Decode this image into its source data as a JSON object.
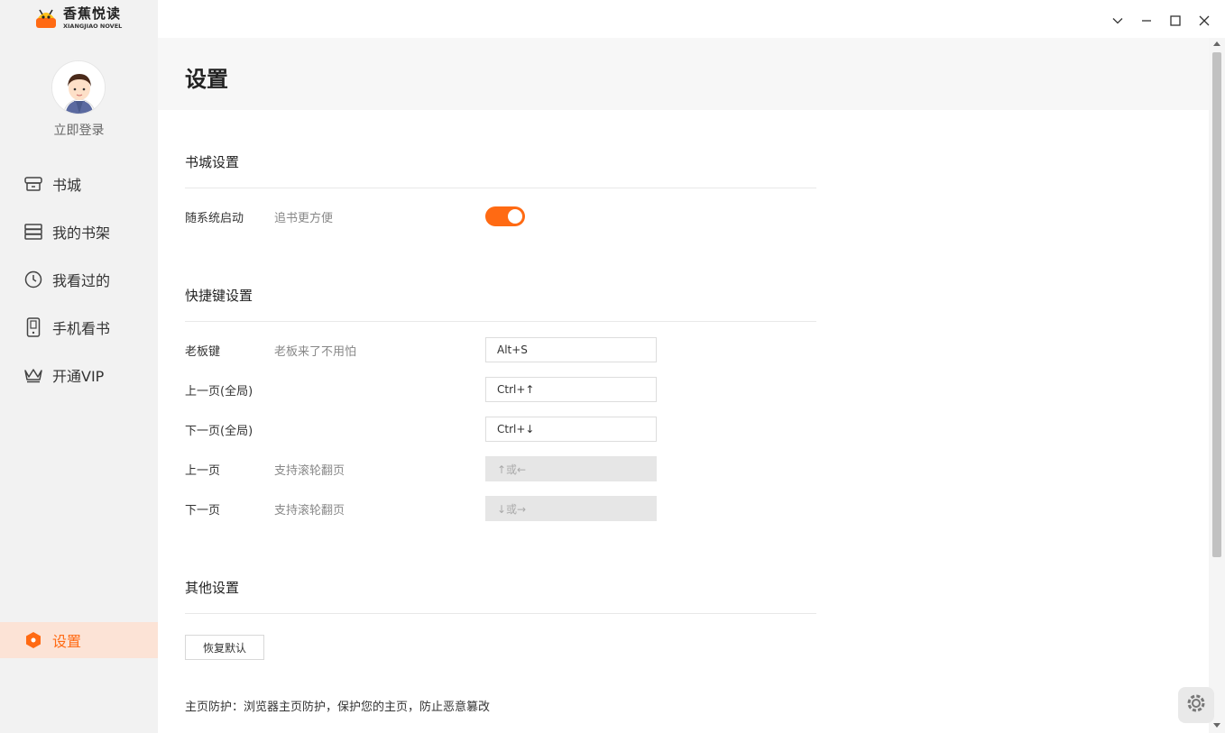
{
  "app": {
    "logo_cn": "香蕉悦读",
    "logo_en": "XIANGJIAO NOVEL"
  },
  "user": {
    "login_label": "立即登录"
  },
  "nav": {
    "items": [
      {
        "label": "书城",
        "icon": "bookstore-icon"
      },
      {
        "label": "我的书架",
        "icon": "bookshelf-icon"
      },
      {
        "label": "我看过的",
        "icon": "history-clock-icon"
      },
      {
        "label": "手机看书",
        "icon": "mobile-phone-icon"
      },
      {
        "label": "开通VIP",
        "icon": "crown-icon"
      }
    ],
    "settings_label": "设置"
  },
  "page": {
    "title": "设置"
  },
  "sections": {
    "bookstore": {
      "title": "书城设置",
      "autostart": {
        "label": "随系统启动",
        "desc": "追书更方便",
        "enabled": true
      }
    },
    "shortcuts": {
      "title": "快捷键设置",
      "rows": [
        {
          "label": "老板键",
          "desc": "老板来了不用怕",
          "value": "Alt+S"
        },
        {
          "label": "上一页(全局)",
          "desc": "",
          "value": "Ctrl+↑"
        },
        {
          "label": "下一页(全局)",
          "desc": "",
          "value": "Ctrl+↓"
        },
        {
          "label": "上一页",
          "desc": "支持滚轮翻页",
          "value": "↑或←"
        },
        {
          "label": "下一页",
          "desc": "支持滚轮翻页",
          "value": "↓或→"
        }
      ]
    },
    "other": {
      "title": "其他设置",
      "reset_label": "恢复默认",
      "homepage_text": "主页防护：浏览器主页防护，保护您的主页，防止恶意篡改"
    }
  },
  "colors": {
    "accent": "#ff6a13",
    "sidebar_bg": "#f2f2f2",
    "active_bg": "#fce3d6"
  }
}
